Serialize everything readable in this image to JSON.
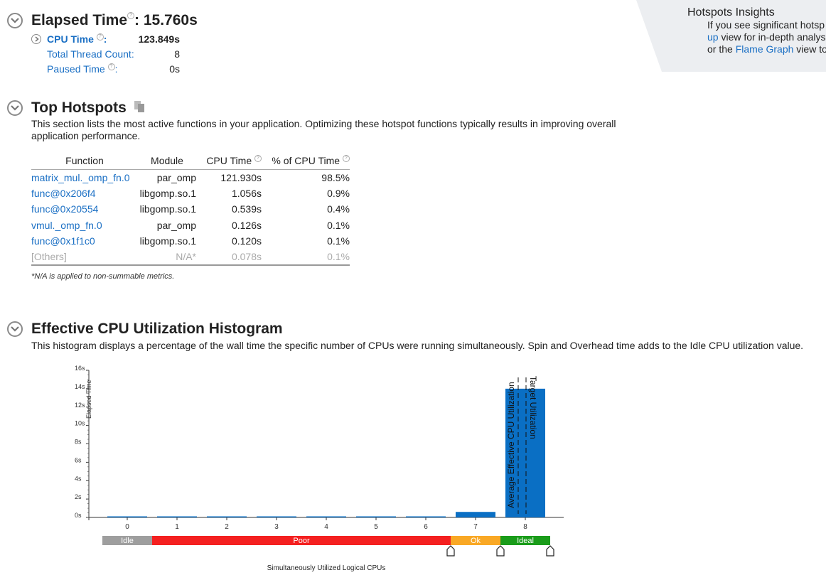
{
  "elapsed": {
    "title": "Elapsed Time",
    "value": ": 15.760s",
    "metrics": [
      {
        "label": "CPU Time",
        "value": "123.849s"
      },
      {
        "label": "Total Thread Count:",
        "value": "8"
      },
      {
        "label": "Paused Time",
        "value": "0s"
      }
    ]
  },
  "insights": {
    "title": "Hotspots Insights",
    "line1": "If you see significant hotsp",
    "line2_link": "up",
    "line2_text": " view for in-depth analys",
    "line3_pre": "or the ",
    "line3_link": "Flame Graph",
    "line3_post": " view to"
  },
  "top_hotspots": {
    "title": "Top Hotspots",
    "description": "This section lists the most active functions in your application. Optimizing these hotspot functions typically results in improving overall application performance.",
    "columns": [
      "Function",
      "Module",
      "CPU Time",
      "% of CPU Time"
    ],
    "rows": [
      {
        "function": "matrix_mul._omp_fn.0",
        "module": "par_omp",
        "cpu_time": "121.930s",
        "pct": "98.5%"
      },
      {
        "function": "func@0x206f4",
        "module": "libgomp.so.1",
        "cpu_time": "1.056s",
        "pct": "0.9%"
      },
      {
        "function": "func@0x20554",
        "module": "libgomp.so.1",
        "cpu_time": "0.539s",
        "pct": "0.4%"
      },
      {
        "function": "vmul._omp_fn.0",
        "module": "par_omp",
        "cpu_time": "0.126s",
        "pct": "0.1%"
      },
      {
        "function": "func@0x1f1c0",
        "module": "libgomp.so.1",
        "cpu_time": "0.120s",
        "pct": "0.1%"
      },
      {
        "function": "[Others]",
        "module": "N/A*",
        "cpu_time": "0.078s",
        "pct": "0.1%"
      }
    ],
    "footnote": "*N/A is applied to non-summable metrics."
  },
  "histogram": {
    "title": "Effective CPU Utilization Histogram",
    "description": "This histogram displays a percentage of the wall time the specific number of CPUs were running simultaneously. Spin and Overhead time adds to the Idle CPU utilization value."
  },
  "chart_data": {
    "type": "bar",
    "categories": [
      "0",
      "1",
      "2",
      "3",
      "4",
      "5",
      "6",
      "7",
      "8"
    ],
    "values": [
      0.05,
      0.05,
      0.05,
      0.05,
      0.05,
      0.1,
      0.1,
      0.6,
      14.0
    ],
    "ylabel": "Elapsed Time",
    "xlabel": "Simultaneously Utilized Logical CPUs",
    "yticks": [
      "0s",
      "2s",
      "4s",
      "6s",
      "8s",
      "10s",
      "12s",
      "14s",
      "16s"
    ],
    "ylim": [
      0,
      16
    ],
    "bar_color": "#0a6fc4",
    "markers": [
      {
        "label": "Average Effective CPU Utilization",
        "x": 7.85
      },
      {
        "label": "Target Utilization",
        "x": 8.0
      }
    ],
    "ranges": [
      {
        "label": "Idle",
        "from": -0.5,
        "to": 0.5,
        "color": "#9e9e9e"
      },
      {
        "label": "Poor",
        "from": 0.5,
        "to": 6.5,
        "color": "#f42020"
      },
      {
        "label": "Ok",
        "from": 6.5,
        "to": 7.5,
        "color": "#f9a825"
      },
      {
        "label": "Ideal",
        "from": 7.5,
        "to": 8.5,
        "color": "#1a9c1a"
      }
    ]
  }
}
